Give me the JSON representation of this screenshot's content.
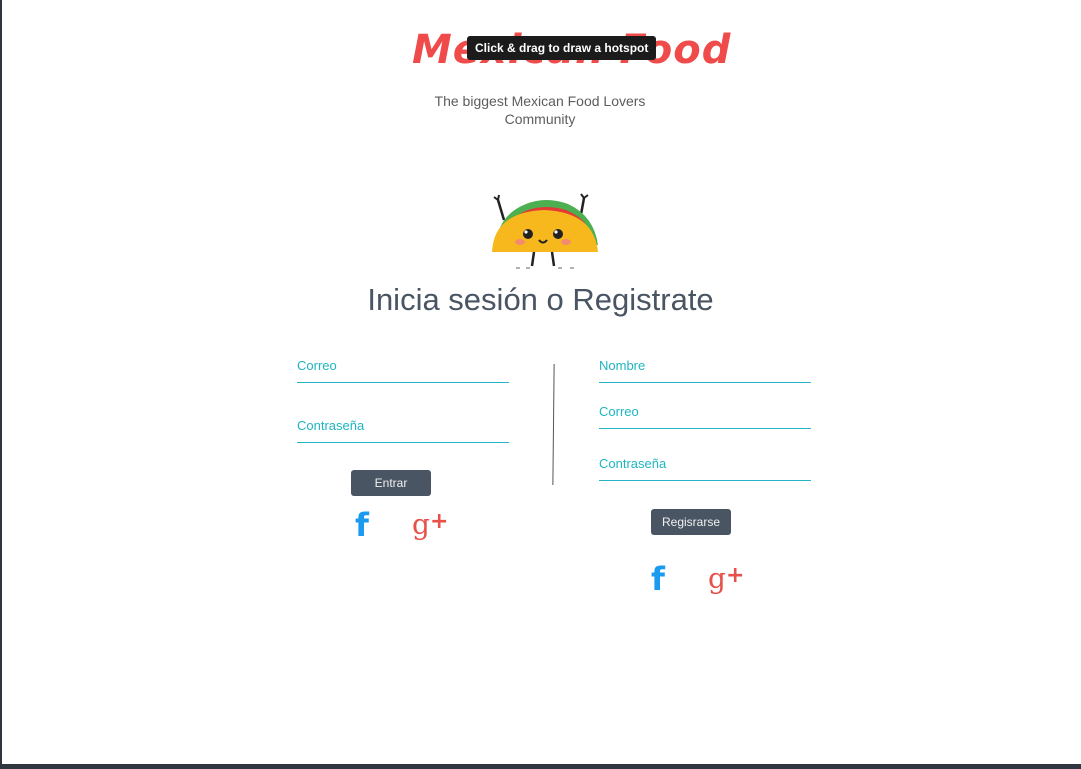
{
  "header": {
    "logo_text": "Mexican Food",
    "tooltip": "Click & drag to draw a hotspot",
    "tagline": "The biggest Mexican Food Lovers Community"
  },
  "title": "Inicia sesión o Registrate",
  "login": {
    "email_label": "Correo",
    "password_label": "Contraseña",
    "submit_label": "Entrar"
  },
  "register": {
    "name_label": "Nombre",
    "email_label": "Correo",
    "password_label": "Contraseña",
    "submit_label": "Regisrarse"
  },
  "social": {
    "facebook_glyph": "f",
    "google_glyph": "g",
    "google_plus_glyph": "+"
  },
  "colors": {
    "accent": "#1fb5c2",
    "button": "#4a5563",
    "facebook": "#1a9bf0",
    "google": "#e8504a",
    "logo": "#ef4b4b"
  }
}
